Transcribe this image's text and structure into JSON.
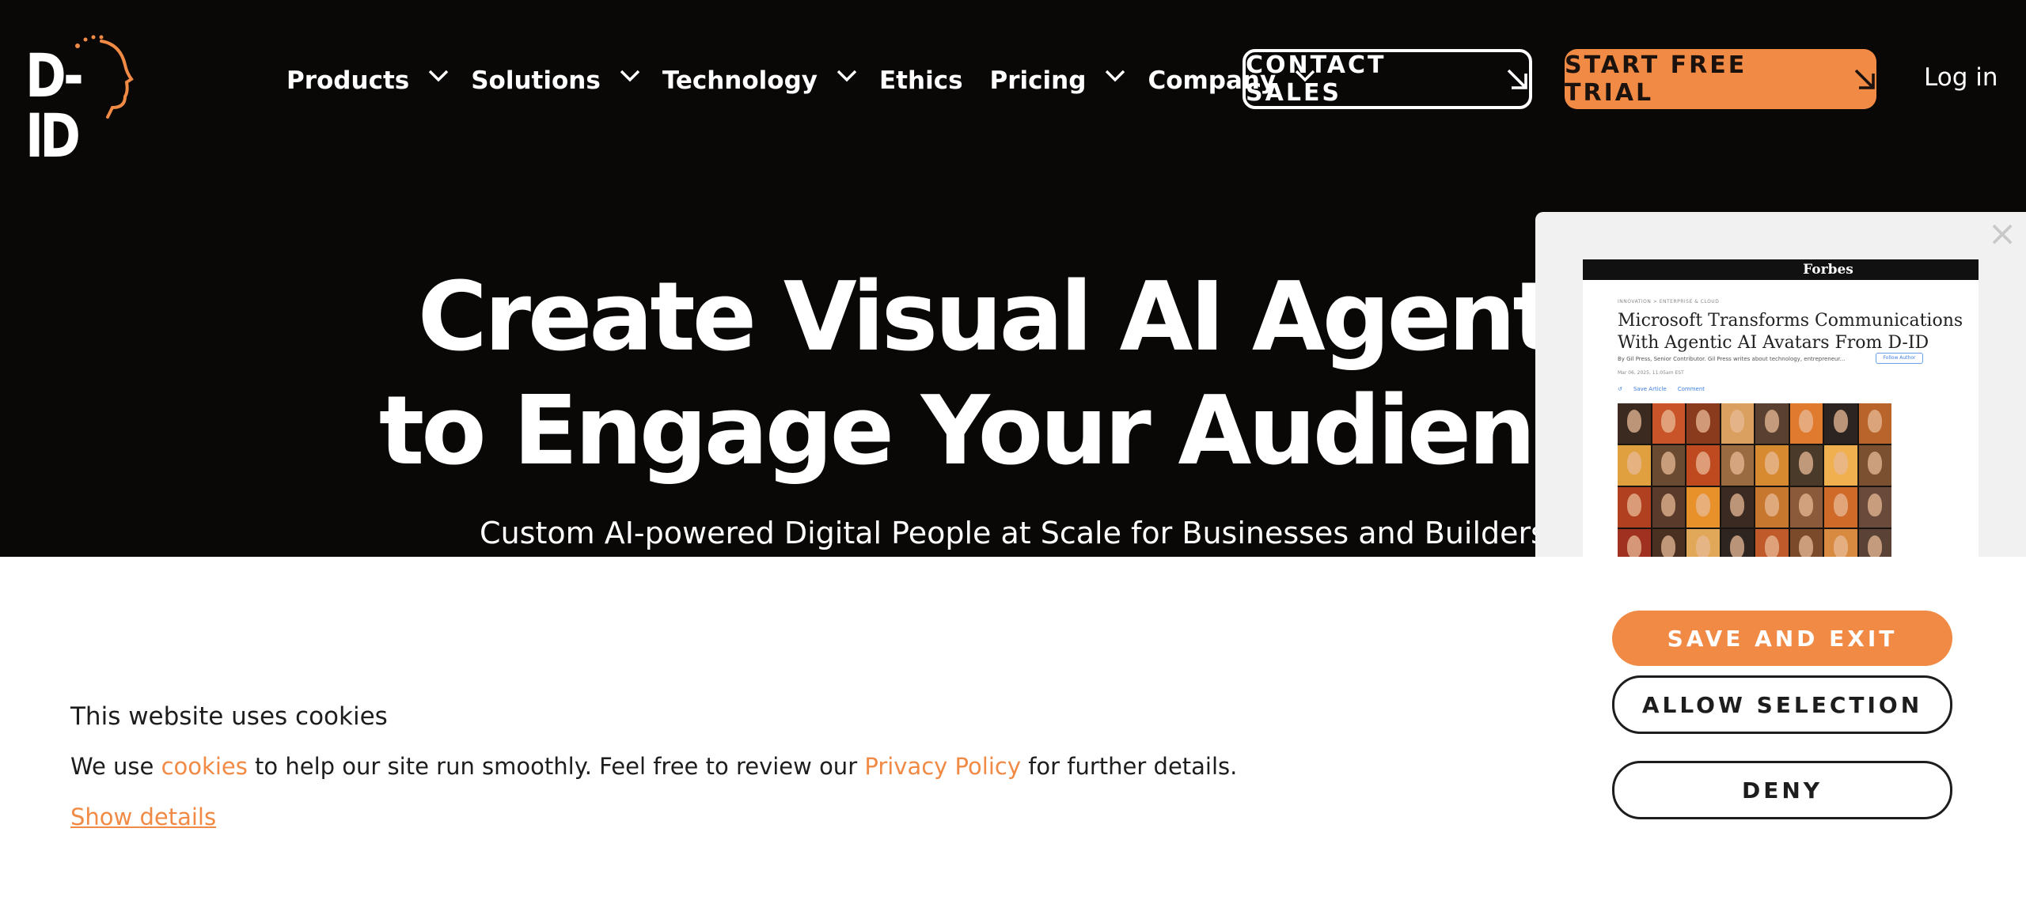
{
  "nav": {
    "logo": "D-ID",
    "items": [
      {
        "label": "Products",
        "dropdown": true
      },
      {
        "label": "Solutions",
        "dropdown": true
      },
      {
        "label": "Technology",
        "dropdown": true
      },
      {
        "label": "Ethics",
        "dropdown": false
      },
      {
        "label": "Pricing",
        "dropdown": true
      },
      {
        "label": "Company",
        "dropdown": true
      }
    ],
    "contact_sales": "CONTACT SALES",
    "start_trial": "START FREE TRIAL",
    "login": "Log in"
  },
  "hero": {
    "title_line1": "Create Visual AI Agents",
    "title_line2": "to Engage Your Audience",
    "subtitle": "Custom AI-powered Digital People at Scale for Businesses and Builders"
  },
  "popup": {
    "close": "×",
    "publication": "Forbes",
    "crumb": "INNOVATION  >  ENTERPRISE & CLOUD",
    "headline": "Microsoft Transforms Communications With Agentic AI Avatars From D-ID",
    "byline": "By Gil Press, Senior Contributor. Gil Press writes about technology, entrepreneur...",
    "follow": "Follow Author",
    "date": "Mar 06, 2025, 11:05am EST",
    "actions": [
      "Save Article",
      "Comment"
    ]
  },
  "cookie": {
    "title": "This website uses cookies",
    "text_before": "We use ",
    "cookies_link": "cookies",
    "text_middle": " to help our site run smoothly. Feel free to review our ",
    "privacy_link": "Privacy Policy",
    "text_after": " for further details.",
    "show_details": "Show details",
    "save_exit": "SAVE AND EXIT",
    "allow_selection": "ALLOW SELECTION",
    "deny": "DENY"
  },
  "colors": {
    "background": "#0a0807",
    "accent": "#f08a45",
    "banner_bg": "#ffffff",
    "text_dark": "#1d1d1d"
  },
  "icons": {
    "dropdown": "chevron-down-icon",
    "cta_arrow": "arrow-down-right-icon",
    "close": "close-icon"
  }
}
